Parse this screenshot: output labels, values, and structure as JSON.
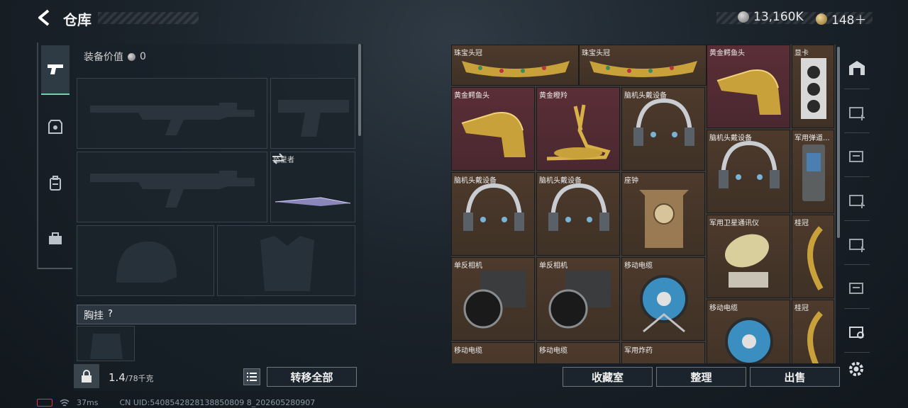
{
  "header": {
    "title": "仓库",
    "currency_silver": "13,160K",
    "currency_gold": "148＋"
  },
  "equipment": {
    "value_label": "装备价值",
    "value": "0",
    "melee_name": "坠星者",
    "chest_label": "胸挂",
    "chest_help": "?"
  },
  "bottom_left": {
    "weight": "1.4",
    "weight_max": "/78千克",
    "transfer_all": "转移全部"
  },
  "status_bar": {
    "ping": "37ms",
    "uid": "CN UID:5408542828138850809 8_202605280907"
  },
  "grid_items": [
    {
      "name": "珠宝头冠"
    },
    {
      "name": "珠宝头冠"
    },
    {
      "name": "黄金鳄鱼头"
    },
    {
      "name": "显卡"
    },
    {
      "name": "黄金鳄鱼头"
    },
    {
      "name": "黄金瞪羚"
    },
    {
      "name": "脑机头戴设备"
    },
    {
      "name": "脑机头戴设备"
    },
    {
      "name": "军用弹道..."
    },
    {
      "name": "脑机头戴设备"
    },
    {
      "name": "脑机头戴设备"
    },
    {
      "name": "座钟"
    },
    {
      "name": "军用卫星通讯仪"
    },
    {
      "name": "桂冠"
    },
    {
      "name": "单反相机"
    },
    {
      "name": "单反相机"
    },
    {
      "name": "移动电缆"
    },
    {
      "name": "移动电缆"
    },
    {
      "name": "桂冠"
    },
    {
      "name": "移动电缆"
    },
    {
      "name": "移动电缆"
    },
    {
      "name": "军用炸药"
    }
  ],
  "bottom_right": {
    "collection": "收藏室",
    "organize": "整理",
    "sell": "出售"
  },
  "colors": {
    "accent": "#6fd0b0",
    "item_red": "#5b2e36",
    "item_brown": "#4d3a2c",
    "battery": "#d93a3a"
  }
}
